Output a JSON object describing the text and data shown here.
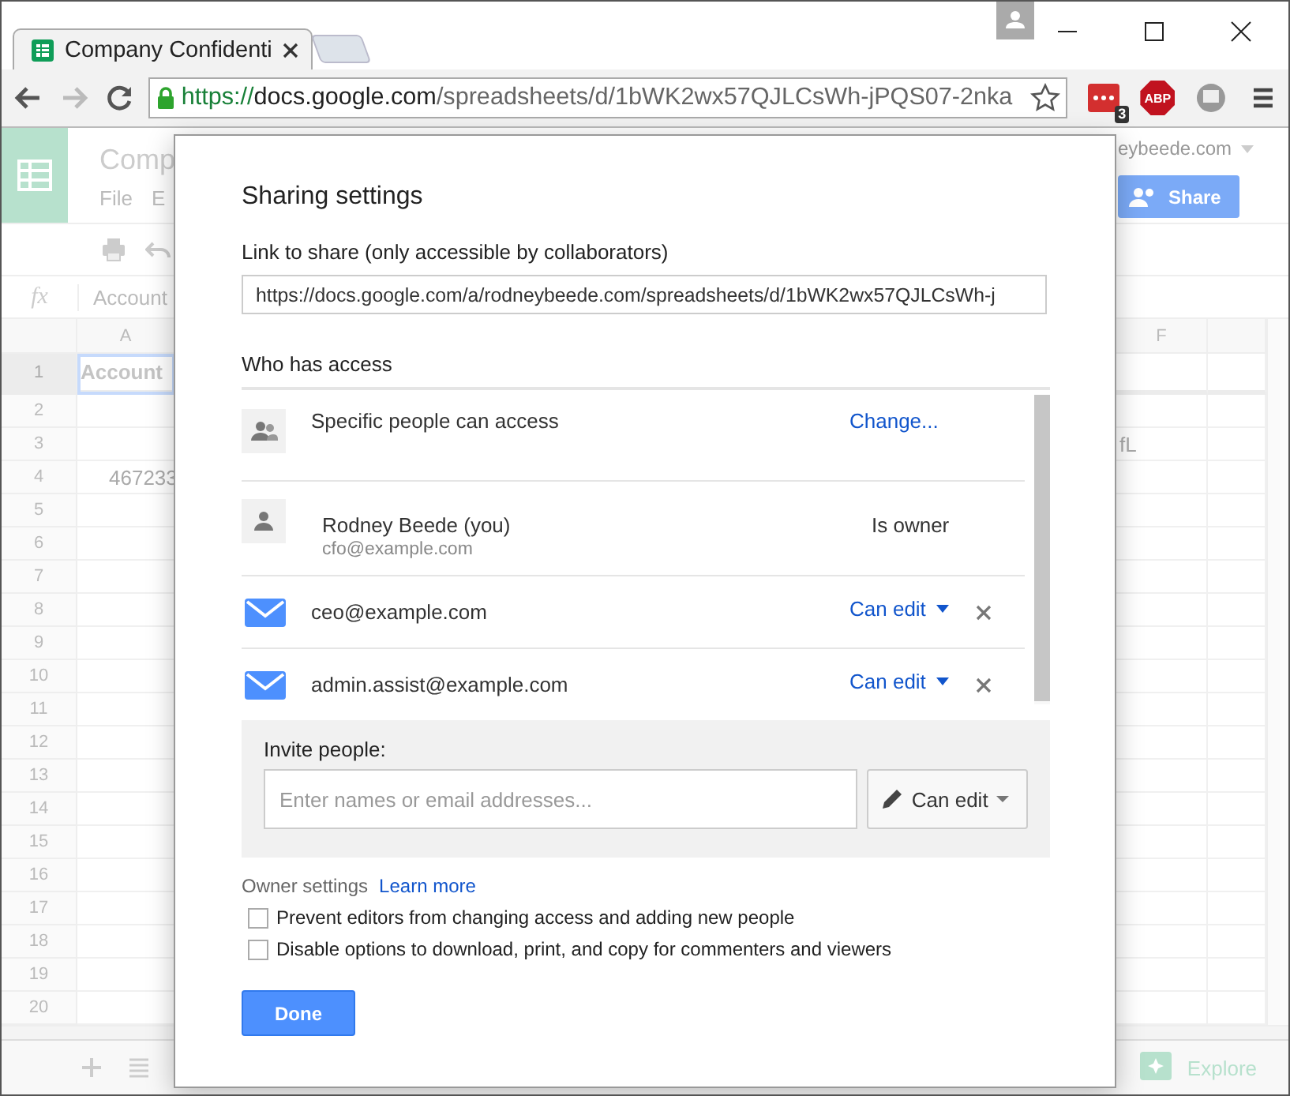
{
  "browser": {
    "tab": {
      "title": "Company Confidenti"
    },
    "address": {
      "scheme": "https://",
      "host": "docs.google.com",
      "path": "/spreadsheets/d/1bWK2wx57QJLCsWh-jPQS07-2nka"
    },
    "extension_badge": "3",
    "adblock_label": "ABP"
  },
  "sheet": {
    "title": "Comp",
    "menus": [
      "File",
      "E"
    ],
    "account": "eybeede.com",
    "share_button": "Share",
    "formula_icon": "fx",
    "formula": "Account",
    "columns": [
      "A",
      "F"
    ],
    "rows": [
      {
        "number": "1",
        "col_a": "Account",
        "selected": true
      },
      {
        "number": "2",
        "selected": false
      },
      {
        "number": "3",
        "col_f": "fL",
        "selected": false
      },
      {
        "number": "4",
        "col_a": "467233",
        "selected": false
      },
      {
        "number": "5",
        "selected": false
      },
      {
        "number": "6",
        "selected": false
      },
      {
        "number": "7",
        "selected": false
      },
      {
        "number": "8",
        "selected": false
      },
      {
        "number": "9",
        "selected": false
      },
      {
        "number": "10",
        "selected": false
      },
      {
        "number": "11",
        "selected": false
      },
      {
        "number": "12",
        "selected": false
      },
      {
        "number": "13",
        "selected": false
      },
      {
        "number": "14",
        "selected": false
      },
      {
        "number": "15",
        "selected": false
      },
      {
        "number": "16",
        "selected": false
      },
      {
        "number": "17",
        "selected": false
      },
      {
        "number": "18",
        "selected": false
      },
      {
        "number": "19",
        "selected": false
      },
      {
        "number": "20",
        "selected": false
      }
    ],
    "explore": "Explore"
  },
  "dialog": {
    "title": "Sharing settings",
    "link_label": "Link to share (only accessible by collaborators)",
    "link_value": "https://docs.google.com/a/rodneybeede.com/spreadsheets/d/1bWK2wx57QJLCsWh-j",
    "access_heading": "Who has access",
    "access": [
      {
        "kind": "visibility",
        "name": "Specific people can access",
        "action": "Change..."
      },
      {
        "kind": "owner",
        "name": "Rodney Beede (you)",
        "email": "cfo@example.com",
        "role": "Is owner"
      },
      {
        "kind": "invitee",
        "name": "ceo@example.com",
        "role": "Can edit"
      },
      {
        "kind": "invitee",
        "name": "admin.assist@example.com",
        "role": "Can edit"
      }
    ],
    "invite": {
      "label": "Invite people:",
      "placeholder": "Enter names or email addresses...",
      "permission": "Can edit"
    },
    "owner_settings": {
      "label": "Owner settings",
      "link": "Learn more",
      "options": [
        {
          "label": "Prevent editors from changing access and adding new people",
          "checked": false
        },
        {
          "label": "Disable options to download, print, and copy for commenters and viewers",
          "checked": false
        }
      ]
    },
    "done": "Done"
  }
}
